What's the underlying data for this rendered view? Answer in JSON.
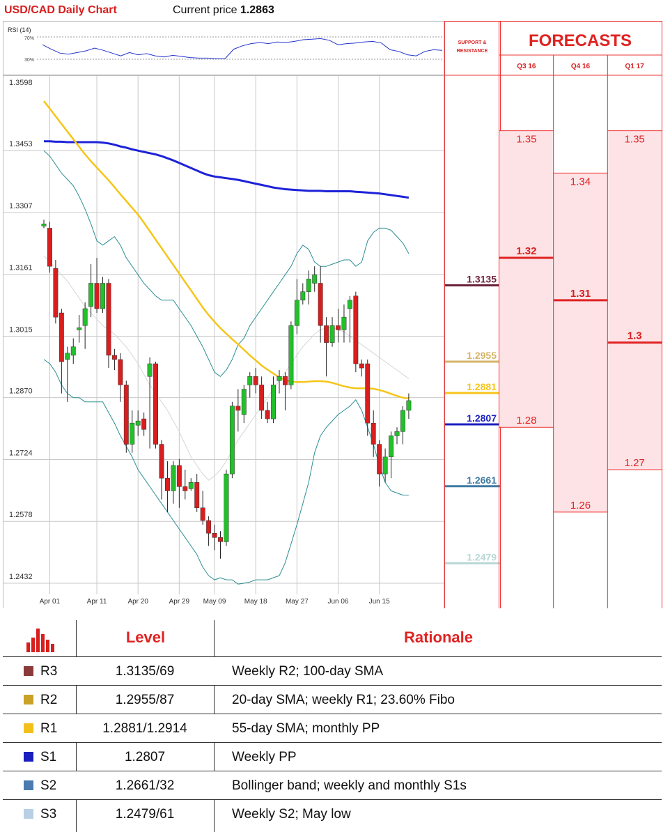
{
  "header": {
    "title": "USD/CAD Daily Chart",
    "price_label": "Current price",
    "price_value": "1.2863"
  },
  "rsi": {
    "label": "RSI (14)",
    "upper": "70%",
    "lower": "30%",
    "upper_value": 70,
    "lower_value": 30,
    "values": [
      56,
      48,
      41,
      39,
      42,
      45,
      50,
      46,
      41,
      36,
      42,
      38,
      40,
      36,
      34,
      37,
      35,
      33,
      32,
      32,
      31,
      31,
      48,
      54,
      58,
      60,
      58,
      61,
      60,
      62,
      65,
      66,
      67,
      64,
      56,
      58,
      59,
      61,
      62,
      59,
      47,
      44,
      38,
      36,
      44,
      47,
      46
    ]
  },
  "colors": {
    "up": "#22c02a",
    "down": "#d81e1e",
    "sma100": "#1e22d8",
    "sma55": "#f5c518",
    "bollinger": "#2a8e94",
    "sma20": "#d6d6d6",
    "accent_red": "#e02222"
  },
  "chart_data": {
    "type": "candlestick",
    "ylim": [
      1.24,
      1.365
    ],
    "y_ticks": [
      "1.3598",
      "1.3453",
      "1.3307",
      "1.3161",
      "1.3015",
      "1.2870",
      "1.2724",
      "1.2578",
      "1.2432"
    ],
    "x_ticks": [
      {
        "label": "Apr 01",
        "index": 1
      },
      {
        "label": "Apr 11",
        "index": 9
      },
      {
        "label": "Apr 20",
        "index": 16
      },
      {
        "label": "Apr 29",
        "index": 23
      },
      {
        "label": "May 09",
        "index": 29
      },
      {
        "label": "May 18",
        "index": 36
      },
      {
        "label": "May 27",
        "index": 43
      },
      {
        "label": "Jun 06",
        "index": 50
      },
      {
        "label": "Jun 15",
        "index": 57
      }
    ],
    "candles": [
      {
        "o": 1.3275,
        "h": 1.329,
        "l": 1.327,
        "c": 1.328
      },
      {
        "o": 1.327,
        "h": 1.3285,
        "l": 1.3165,
        "c": 1.318
      },
      {
        "o": 1.3175,
        "h": 1.3195,
        "l": 1.3045,
        "c": 1.306
      },
      {
        "o": 1.307,
        "h": 1.308,
        "l": 1.288,
        "c": 1.2955
      },
      {
        "o": 1.296,
        "h": 1.299,
        "l": 1.286,
        "c": 1.2975
      },
      {
        "o": 1.297,
        "h": 1.301,
        "l": 1.295,
        "c": 1.299
      },
      {
        "o": 1.303,
        "h": 1.3065,
        "l": 1.3,
        "c": 1.3035
      },
      {
        "o": 1.304,
        "h": 1.3095,
        "l": 1.2985,
        "c": 1.308
      },
      {
        "o": 1.3085,
        "h": 1.3185,
        "l": 1.306,
        "c": 1.314
      },
      {
        "o": 1.314,
        "h": 1.32,
        "l": 1.307,
        "c": 1.308
      },
      {
        "o": 1.308,
        "h": 1.3155,
        "l": 1.307,
        "c": 1.314
      },
      {
        "o": 1.314,
        "h": 1.315,
        "l": 1.294,
        "c": 1.297
      },
      {
        "o": 1.297,
        "h": 1.2985,
        "l": 1.2935,
        "c": 1.296
      },
      {
        "o": 1.296,
        "h": 1.2975,
        "l": 1.286,
        "c": 1.29
      },
      {
        "o": 1.29,
        "h": 1.291,
        "l": 1.274,
        "c": 1.276
      },
      {
        "o": 1.276,
        "h": 1.284,
        "l": 1.274,
        "c": 1.281
      },
      {
        "o": 1.2805,
        "h": 1.284,
        "l": 1.278,
        "c": 1.2815
      },
      {
        "o": 1.282,
        "h": 1.2835,
        "l": 1.278,
        "c": 1.2795
      },
      {
        "o": 1.292,
        "h": 1.2965,
        "l": 1.275,
        "c": 1.295
      },
      {
        "o": 1.295,
        "h": 1.2955,
        "l": 1.275,
        "c": 1.276
      },
      {
        "o": 1.276,
        "h": 1.277,
        "l": 1.263,
        "c": 1.268
      },
      {
        "o": 1.268,
        "h": 1.272,
        "l": 1.26,
        "c": 1.265
      },
      {
        "o": 1.265,
        "h": 1.272,
        "l": 1.262,
        "c": 1.271
      },
      {
        "o": 1.271,
        "h": 1.2725,
        "l": 1.261,
        "c": 1.266
      },
      {
        "o": 1.266,
        "h": 1.27,
        "l": 1.263,
        "c": 1.265
      },
      {
        "o": 1.2655,
        "h": 1.268,
        "l": 1.265,
        "c": 1.267
      },
      {
        "o": 1.267,
        "h": 1.269,
        "l": 1.26,
        "c": 1.261
      },
      {
        "o": 1.261,
        "h": 1.265,
        "l": 1.257,
        "c": 1.258
      },
      {
        "o": 1.258,
        "h": 1.259,
        "l": 1.252,
        "c": 1.255
      },
      {
        "o": 1.255,
        "h": 1.257,
        "l": 1.251,
        "c": 1.254
      },
      {
        "o": 1.254,
        "h": 1.2555,
        "l": 1.249,
        "c": 1.253
      },
      {
        "o": 1.253,
        "h": 1.27,
        "l": 1.252,
        "c": 1.269
      },
      {
        "o": 1.269,
        "h": 1.286,
        "l": 1.268,
        "c": 1.285
      },
      {
        "o": 1.285,
        "h": 1.289,
        "l": 1.279,
        "c": 1.284
      },
      {
        "o": 1.283,
        "h": 1.29,
        "l": 1.281,
        "c": 1.289
      },
      {
        "o": 1.29,
        "h": 1.293,
        "l": 1.287,
        "c": 1.292
      },
      {
        "o": 1.292,
        "h": 1.294,
        "l": 1.288,
        "c": 1.29
      },
      {
        "o": 1.29,
        "h": 1.292,
        "l": 1.282,
        "c": 1.284
      },
      {
        "o": 1.284,
        "h": 1.286,
        "l": 1.281,
        "c": 1.282
      },
      {
        "o": 1.282,
        "h": 1.292,
        "l": 1.281,
        "c": 1.29
      },
      {
        "o": 1.291,
        "h": 1.2935,
        "l": 1.288,
        "c": 1.292
      },
      {
        "o": 1.292,
        "h": 1.293,
        "l": 1.284,
        "c": 1.29
      },
      {
        "o": 1.29,
        "h": 1.305,
        "l": 1.289,
        "c": 1.304
      },
      {
        "o": 1.304,
        "h": 1.315,
        "l": 1.302,
        "c": 1.31
      },
      {
        "o": 1.31,
        "h": 1.314,
        "l": 1.309,
        "c": 1.312
      },
      {
        "o": 1.312,
        "h": 1.317,
        "l": 1.309,
        "c": 1.315
      },
      {
        "o": 1.314,
        "h": 1.318,
        "l": 1.312,
        "c": 1.316
      },
      {
        "o": 1.314,
        "h": 1.318,
        "l": 1.3,
        "c": 1.304
      },
      {
        "o": 1.304,
        "h": 1.306,
        "l": 1.292,
        "c": 1.3
      },
      {
        "o": 1.3,
        "h": 1.306,
        "l": 1.299,
        "c": 1.304
      },
      {
        "o": 1.304,
        "h": 1.308,
        "l": 1.3,
        "c": 1.303
      },
      {
        "o": 1.303,
        "h": 1.309,
        "l": 1.3,
        "c": 1.306
      },
      {
        "o": 1.308,
        "h": 1.311,
        "l": 1.3,
        "c": 1.31
      },
      {
        "o": 1.311,
        "h": 1.312,
        "l": 1.293,
        "c": 1.295
      },
      {
        "o": 1.295,
        "h": 1.296,
        "l": 1.292,
        "c": 1.294
      },
      {
        "o": 1.295,
        "h": 1.296,
        "l": 1.278,
        "c": 1.281
      },
      {
        "o": 1.281,
        "h": 1.284,
        "l": 1.273,
        "c": 1.276
      },
      {
        "o": 1.276,
        "h": 1.277,
        "l": 1.266,
        "c": 1.269
      },
      {
        "o": 1.269,
        "h": 1.275,
        "l": 1.267,
        "c": 1.273
      },
      {
        "o": 1.273,
        "h": 1.279,
        "l": 1.268,
        "c": 1.278
      },
      {
        "o": 1.278,
        "h": 1.28,
        "l": 1.276,
        "c": 1.279
      },
      {
        "o": 1.279,
        "h": 1.285,
        "l": 1.276,
        "c": 1.284
      },
      {
        "o": 1.284,
        "h": 1.288,
        "l": 1.282,
        "c": 1.2863
      }
    ],
    "sma100": [
      1.3475,
      1.3475,
      1.3474,
      1.3474,
      1.3473,
      1.3473,
      1.3473,
      1.3473,
      1.3473,
      1.3473,
      1.3472,
      1.347,
      1.3467,
      1.3463,
      1.346,
      1.3456,
      1.3453,
      1.345,
      1.3447,
      1.3444,
      1.344,
      1.3435,
      1.343,
      1.3424,
      1.3418,
      1.3412,
      1.3406,
      1.34,
      1.3395,
      1.3392,
      1.339,
      1.3388,
      1.3386,
      1.3384,
      1.3381,
      1.3378,
      1.3375,
      1.3372,
      1.3369,
      1.3366,
      1.3364,
      1.3362,
      1.3361,
      1.336,
      1.3359,
      1.3358,
      1.3358,
      1.3358,
      1.3357,
      1.3357,
      1.3357,
      1.3357,
      1.3357,
      1.3356,
      1.3355,
      1.3354,
      1.3353,
      1.3352,
      1.335,
      1.3348,
      1.3346,
      1.3344,
      1.3342
    ],
    "sma55": [
      1.357,
      1.3552,
      1.3534,
      1.3516,
      1.3498,
      1.348,
      1.3462,
      1.3444,
      1.3428,
      1.3413,
      1.3398,
      1.3383,
      1.3367,
      1.335,
      1.3334,
      1.3318,
      1.3302,
      1.3283,
      1.3263,
      1.3243,
      1.3223,
      1.3203,
      1.3183,
      1.3163,
      1.3143,
      1.3123,
      1.3103,
      1.3083,
      1.3065,
      1.3049,
      1.3034,
      1.3021,
      1.3008,
      1.2996,
      1.2983,
      1.297,
      1.2958,
      1.2946,
      1.2936,
      1.2927,
      1.2918,
      1.2912,
      1.2908,
      1.2907,
      1.2907,
      1.2908,
      1.2909,
      1.2909,
      1.2908,
      1.2905,
      1.2901,
      1.2897,
      1.2894,
      1.2892,
      1.2892,
      1.2892,
      1.2891,
      1.2888,
      1.2884,
      1.2879,
      1.2874,
      1.287,
      1.2868
    ],
    "bollinger_upper": [
      1.3453,
      1.344,
      1.342,
      1.34,
      1.3385,
      1.337,
      1.3345,
      1.3315,
      1.328,
      1.324,
      1.323,
      1.324,
      1.325,
      1.323,
      1.32,
      1.318,
      1.316,
      1.314,
      1.3125,
      1.311,
      1.31,
      1.31,
      1.31,
      1.308,
      1.306,
      1.304,
      1.3015,
      1.299,
      1.296,
      1.293,
      1.292,
      1.2935,
      1.296,
      1.2995,
      1.301,
      1.304,
      1.306,
      1.308,
      1.31,
      1.312,
      1.314,
      1.316,
      1.318,
      1.321,
      1.323,
      1.322,
      1.319,
      1.318,
      1.318,
      1.3185,
      1.319,
      1.3195,
      1.3195,
      1.318,
      1.319,
      1.324,
      1.326,
      1.327,
      1.327,
      1.3265,
      1.325,
      1.3235,
      1.321
    ],
    "bollinger_lower": [
      1.296,
      1.295,
      1.293,
      1.29,
      1.288,
      1.287,
      1.287,
      1.286,
      1.286,
      1.286,
      1.286,
      1.2835,
      1.281,
      1.278,
      1.2755,
      1.273,
      1.27,
      1.268,
      1.266,
      1.264,
      1.262,
      1.26,
      1.258,
      1.256,
      1.254,
      1.252,
      1.25,
      1.247,
      1.245,
      1.244,
      1.2445,
      1.244,
      1.244,
      1.243,
      1.2432,
      1.2435,
      1.244,
      1.244,
      1.244,
      1.2445,
      1.245,
      1.248,
      1.2525,
      1.257,
      1.262,
      1.267,
      1.274,
      1.278,
      1.28,
      1.2815,
      1.283,
      1.284,
      1.285,
      1.2865,
      1.284,
      1.28,
      1.276,
      1.271,
      1.267,
      1.265,
      1.2645,
      1.264,
      1.264
    ],
    "sma20": [
      1.3205,
      1.319,
      1.3175,
      1.316,
      1.3145,
      1.3125,
      1.3105,
      1.3085,
      1.307,
      1.3055,
      1.304,
      1.303,
      1.302,
      1.3005,
      1.299,
      1.297,
      1.295,
      1.2925,
      1.29,
      1.288,
      1.286,
      1.284,
      1.2815,
      1.279,
      1.276,
      1.273,
      1.271,
      1.269,
      1.2675,
      1.2685,
      1.27,
      1.272,
      1.2745,
      1.277,
      1.279,
      1.281,
      1.283,
      1.285,
      1.287,
      1.289,
      1.291,
      1.293,
      1.295,
      1.297,
      1.299,
      1.3005,
      1.302,
      1.303,
      1.3035,
      1.3035,
      1.303,
      1.3025,
      1.3015,
      1.3005,
      1.2995,
      1.2985,
      1.2975,
      1.2965,
      1.2955,
      1.2945,
      1.2935,
      1.2925,
      1.2915
    ]
  },
  "support_resistance": {
    "header_line1": "SUPPORT &",
    "header_line2": "RESISTANCE",
    "levels": [
      {
        "label": "1.3135",
        "value": 1.3135,
        "color": "#6b1f3a"
      },
      {
        "label": "1.2955",
        "value": 1.2955,
        "color": "#d6b46a"
      },
      {
        "label": "1.2881",
        "value": 1.2881,
        "color": "#f5c518"
      },
      {
        "label": "1.2807",
        "value": 1.2807,
        "color": "#1a1fbf"
      },
      {
        "label": "1.2661",
        "value": 1.2661,
        "color": "#3f7ba3"
      },
      {
        "label": "1.2479",
        "value": 1.2479,
        "color": "#b8d8d6"
      }
    ]
  },
  "forecasts": {
    "title": "FORECASTS",
    "columns": [
      {
        "label": "Q3 16",
        "high_label": "1.35",
        "high": 1.35,
        "mid_label": "1.32",
        "mid": 1.32,
        "low_label": "1.28",
        "low": 1.28
      },
      {
        "label": "Q4 16",
        "high_label": "1.34",
        "high": 1.34,
        "mid_label": "1.31",
        "mid": 1.31,
        "low_label": "1.26",
        "low": 1.26
      },
      {
        "label": "Q1 17",
        "high_label": "1.35",
        "high": 1.35,
        "mid_label": "1.3",
        "mid": 1.3,
        "low_label": "1.27",
        "low": 1.27
      }
    ]
  },
  "table": {
    "headers": {
      "level": "Level",
      "rationale": "Rationale"
    },
    "rows": [
      {
        "name": "R3",
        "level": "1.3135/69",
        "rationale": "Weekly R2; 100-day SMA",
        "color": "#8b3a3a"
      },
      {
        "name": "R2",
        "level": "1.2955/87",
        "rationale": "20-day SMA; weekly R1; 23.60% Fibo",
        "color": "#c9a227"
      },
      {
        "name": "R1",
        "level": "1.2881/1.2914",
        "rationale": "55-day SMA; monthly PP",
        "color": "#f2c01a"
      },
      {
        "name": "S1",
        "level": "1.2807",
        "rationale": "Weekly PP",
        "color": "#1a1fbf"
      },
      {
        "name": "S2",
        "level": "1.2661/32",
        "rationale": "Bollinger band; weekly and monthly S1s",
        "color": "#4a7ab0"
      },
      {
        "name": "S3",
        "level": "1.2479/61",
        "rationale": "Weekly S2; May low",
        "color": "#b9cfe6"
      }
    ]
  }
}
